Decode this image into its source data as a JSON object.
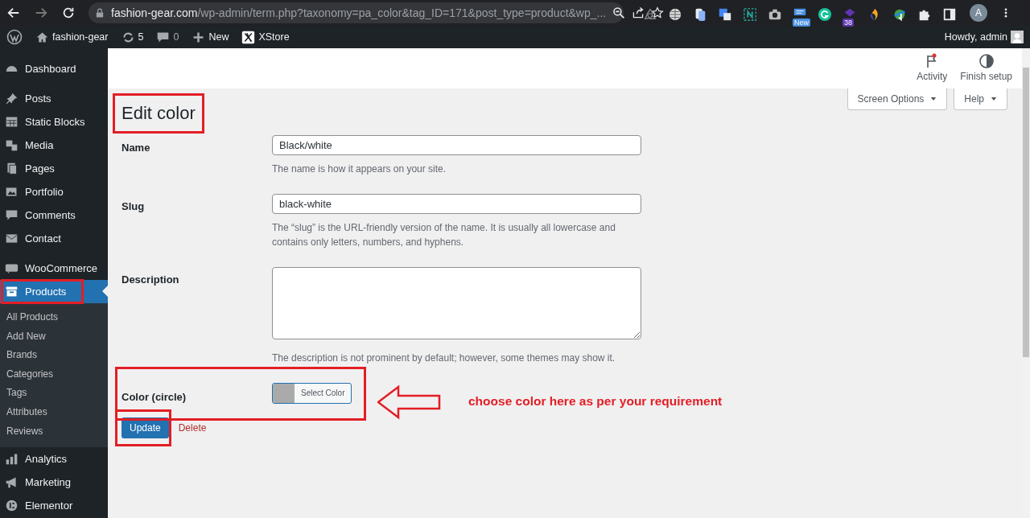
{
  "browser": {
    "url_host": "fashion-gear.com",
    "url_path": "/wp-admin/term.php?taxonomy=pa_color&tag_ID=171&post_type=product&wp_...",
    "extensions": [
      {
        "kind": "recycle"
      },
      {
        "kind": "globe"
      },
      {
        "kind": "files"
      },
      {
        "kind": "translate"
      },
      {
        "kind": "n"
      },
      {
        "kind": "camera"
      },
      {
        "kind": "stack",
        "badge": "New"
      },
      {
        "kind": "g"
      },
      {
        "kind": "gem",
        "badge": "38"
      },
      {
        "kind": "flame"
      },
      {
        "kind": "download"
      },
      {
        "kind": "puzzle"
      },
      {
        "kind": "panel"
      }
    ],
    "profile_initial": "A"
  },
  "admin_bar": {
    "items": [
      {
        "kind": "logo"
      },
      {
        "kind": "home",
        "label": "fashion-gear"
      },
      {
        "kind": "updates",
        "label": "5"
      },
      {
        "kind": "comments",
        "label": "0"
      },
      {
        "kind": "plus",
        "label": "New"
      },
      {
        "kind": "xstore",
        "label": "XStore"
      }
    ],
    "greeting": "Howdy, admin"
  },
  "sidebar": {
    "groups": [
      [
        {
          "kind": "dashboard",
          "label": "Dashboard",
          "selected": false
        }
      ],
      [
        {
          "kind": "pin",
          "label": "Posts",
          "selected": false
        },
        {
          "kind": "grid",
          "label": "Static Blocks",
          "selected": false
        },
        {
          "kind": "media",
          "label": "Media",
          "selected": false
        },
        {
          "kind": "pages",
          "label": "Pages",
          "selected": false
        },
        {
          "kind": "portfolio",
          "label": "Portfolio",
          "selected": false
        },
        {
          "kind": "comment",
          "label": "Comments",
          "selected": false
        },
        {
          "kind": "mail",
          "label": "Contact",
          "selected": false
        }
      ],
      [
        {
          "kind": "woo",
          "label": "WooCommerce",
          "selected": false
        },
        {
          "kind": "archive",
          "label": "Products",
          "selected": true,
          "children": [
            {
              "label": "All Products"
            },
            {
              "label": "Add New"
            },
            {
              "label": "Brands"
            },
            {
              "label": "Categories"
            },
            {
              "label": "Tags"
            },
            {
              "label": "Attributes"
            },
            {
              "label": "Reviews"
            }
          ]
        },
        {
          "kind": "chart",
          "label": "Analytics",
          "selected": false
        },
        {
          "kind": "megaphone",
          "label": "Marketing",
          "selected": false
        },
        {
          "kind": "elementor",
          "label": "Elementor",
          "selected": false
        }
      ]
    ]
  },
  "header": {
    "items": [
      {
        "kind": "flag",
        "label": "Activity",
        "notification": true
      },
      {
        "kind": "contrast",
        "label": "Finish setup",
        "notification": false
      }
    ],
    "tabs": [
      "Screen Options",
      "Help"
    ]
  },
  "page_title": "Edit color",
  "fields": [
    {
      "kind": "text",
      "label": "Name",
      "value": "Black/white",
      "description": "The name is how it appears on your site."
    },
    {
      "kind": "text",
      "label": "Slug",
      "value": "black-white",
      "description": "The “slug” is the URL-friendly version of the name. It is usually all lowercase and contains only letters, numbers, and hyphens."
    },
    {
      "kind": "textarea",
      "label": "Description",
      "description": "The description is not prominent by default; however, some themes may show it."
    },
    {
      "kind": "color",
      "label": "Color (circle)",
      "button": "Select Color",
      "color": "#aaaaaa"
    }
  ],
  "actions": {
    "primary": "Update",
    "delete": "Delete"
  },
  "annotation": "choose color here as per your requirement"
}
